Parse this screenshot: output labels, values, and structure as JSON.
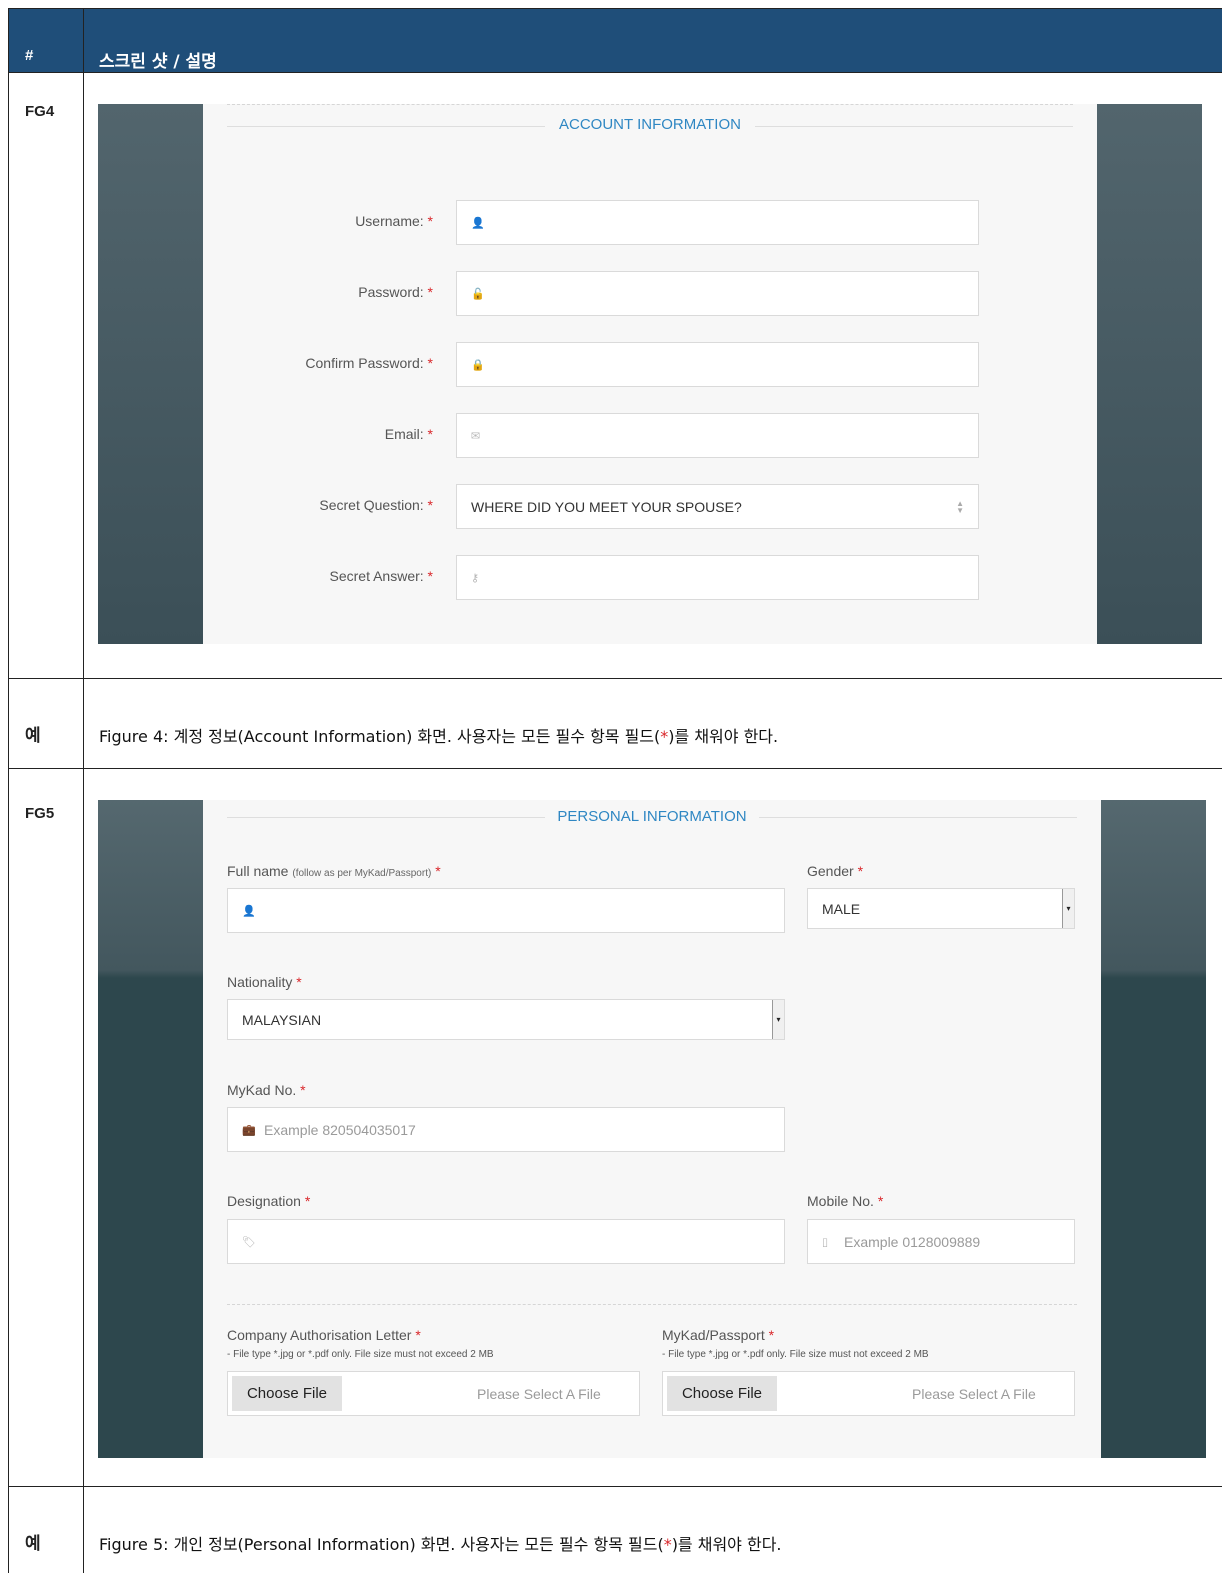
{
  "header": {
    "num": "#",
    "title": "스크린 샷 / 설명"
  },
  "rows": {
    "fg4": {
      "id": "FG4"
    },
    "caption4": {
      "id": "예",
      "text_before": "Figure 4: 계정 정보(Account Information) 화면. 사용자는 모든 필수 항목 필드(",
      "star": "*",
      "text_after": ")를 채워야 한다."
    },
    "fg5": {
      "id": "FG5"
    },
    "caption5": {
      "id": "예",
      "text_before": "Figure 5: 개인 정보(Personal Information) 화면. 사용자는 모든 필수 항목 필드(",
      "star": "*",
      "text_after": ")를 채워야 한다."
    }
  },
  "account": {
    "section_title": "ACCOUNT INFORMATION",
    "required_mark": "*",
    "fields": [
      {
        "label": "Username:",
        "icon": "user-icon",
        "glyph": "👤",
        "value": ""
      },
      {
        "label": "Password:",
        "icon": "unlock-icon",
        "glyph": "🔓",
        "value": ""
      },
      {
        "label": "Confirm Password:",
        "icon": "lock-icon",
        "glyph": "🔒",
        "value": ""
      },
      {
        "label": "Email:",
        "icon": "envelope-icon",
        "glyph": "✉",
        "value": ""
      },
      {
        "label": "Secret Question:",
        "icon": "",
        "glyph": "",
        "value": "WHERE DID YOU MEET YOUR SPOUSE?"
      },
      {
        "label": "Secret Answer:",
        "icon": "key-icon",
        "glyph": "⚷",
        "value": ""
      }
    ]
  },
  "personal": {
    "section_title": "PERSONAL INFORMATION",
    "required_mark": "*",
    "full_name": {
      "label": "Full name",
      "note": "(follow as per MyKad/Passport)",
      "icon": "user-icon",
      "glyph": "👤"
    },
    "gender": {
      "label": "Gender",
      "value": "MALE"
    },
    "nationality": {
      "label": "Nationality",
      "value": "MALAYSIAN"
    },
    "mykad": {
      "label": "MyKad No.",
      "placeholder": "Example 820504035017",
      "icon": "briefcase-icon",
      "glyph": "💼"
    },
    "designation": {
      "label": "Designation",
      "icon": "tags-icon",
      "glyph": "🏷"
    },
    "mobile": {
      "label": "Mobile No.",
      "placeholder": "Example 0128009889",
      "icon": "mobile-icon",
      "glyph": "▯"
    },
    "company_letter": {
      "label": "Company Authorisation Letter",
      "hint": "- File type *.jpg or *.pdf only. File size must not exceed 2 MB",
      "button": "Choose File",
      "placeholder": "Please Select A File"
    },
    "mykad_passport": {
      "label": "MyKad/Passport",
      "hint": "- File type *.jpg or *.pdf only. File size must not exceed 2 MB",
      "button": "Choose File",
      "placeholder": "Please Select A File"
    }
  },
  "colors": {
    "header_bg": "#1f4e79",
    "accent": "#2f87c3",
    "required": "#d9262a",
    "side_panel": "#3b4f57"
  }
}
